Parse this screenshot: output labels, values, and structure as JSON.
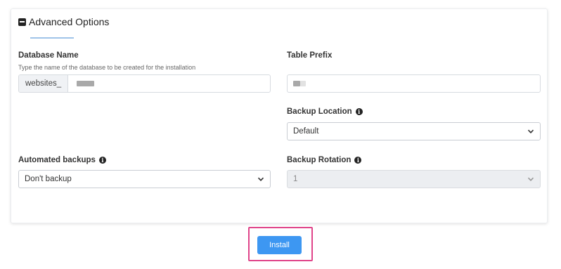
{
  "section": {
    "title": "Advanced Options"
  },
  "database": {
    "label": "Database Name",
    "hint": "Type the name of the database to be created for the installation",
    "prefix": "websites_"
  },
  "table_prefix": {
    "label": "Table Prefix"
  },
  "backup_location": {
    "label": "Backup Location",
    "value": "Default"
  },
  "automated_backups": {
    "label": "Automated backups",
    "value": "Don't backup"
  },
  "backup_rotation": {
    "label": "Backup Rotation",
    "value": "1"
  },
  "actions": {
    "install_label": "Install"
  },
  "colors": {
    "primary": "#3d97f2",
    "highlight": "#e0458a"
  }
}
